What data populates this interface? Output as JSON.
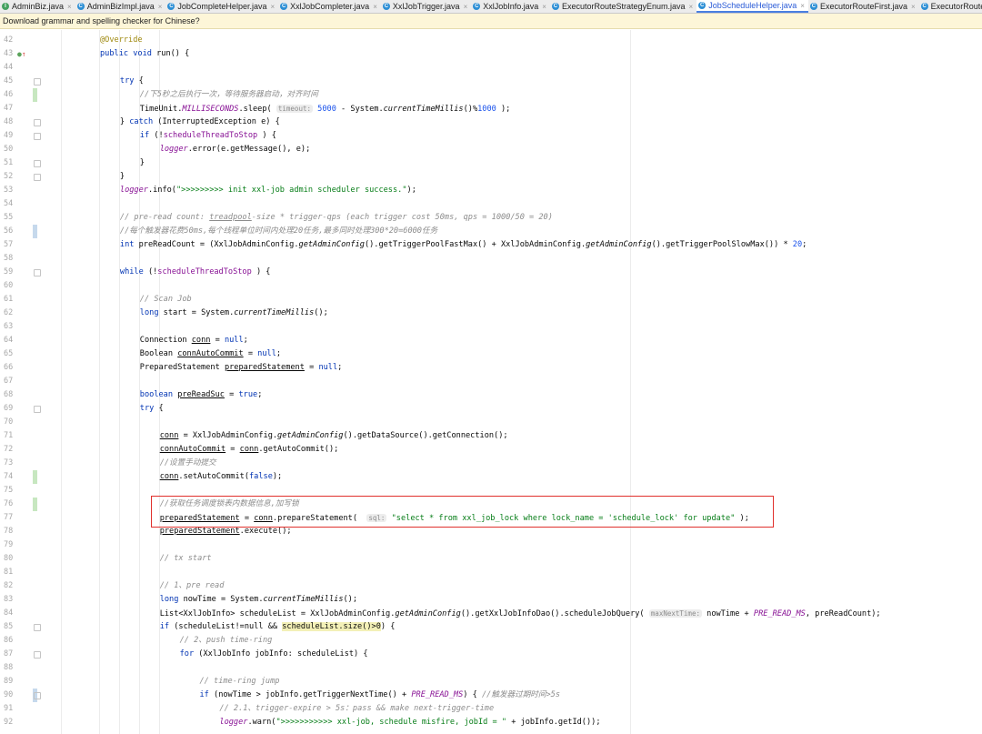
{
  "tabs": [
    {
      "label": "AdminBiz.java",
      "icon": "interface-icon",
      "kind": "iface",
      "active": false
    },
    {
      "label": "AdminBizImpl.java",
      "icon": "class-icon",
      "kind": "class",
      "active": false
    },
    {
      "label": "JobCompleteHelper.java",
      "icon": "class-icon",
      "kind": "class",
      "active": false
    },
    {
      "label": "XxlJobCompleter.java",
      "icon": "class-icon",
      "kind": "class",
      "active": false
    },
    {
      "label": "XxlJobTrigger.java",
      "icon": "class-icon",
      "kind": "class",
      "active": false
    },
    {
      "label": "XxlJobInfo.java",
      "icon": "class-icon",
      "kind": "class",
      "active": false
    },
    {
      "label": "ExecutorRouteStrategyEnum.java",
      "icon": "enum-icon",
      "kind": "class",
      "active": false
    },
    {
      "label": "JobScheduleHelper.java",
      "icon": "class-icon",
      "kind": "class",
      "active": true
    },
    {
      "label": "ExecutorRouteFirst.java",
      "icon": "class-icon",
      "kind": "class",
      "active": false
    },
    {
      "label": "ExecutorRouter.java",
      "icon": "class-icon",
      "kind": "class",
      "active": false
    }
  ],
  "notification": "Download grammar and spelling checker for Chinese?",
  "highlight_color": "#e0302c",
  "lines": [
    {
      "n": "42",
      "indent": 0,
      "code": [
        [
          "ann",
          "@Override"
        ]
      ]
    },
    {
      "n": "43",
      "indent": 0,
      "code": [
        [
          "kw",
          "public void "
        ],
        [
          "",
          "run() {"
        ]
      ],
      "marker": "override"
    },
    {
      "n": "44",
      "indent": 0,
      "code": []
    },
    {
      "n": "45",
      "indent": 1,
      "code": [
        [
          "kw",
          "try"
        ],
        [
          "",
          " {"
        ]
      ],
      "fold": true
    },
    {
      "n": "46",
      "indent": 2,
      "code": [
        [
          "cm",
          "//下5秒之后执行一次，等待服务器启动，对齐时间"
        ]
      ],
      "change": "add"
    },
    {
      "n": "47",
      "indent": 2,
      "code": [
        [
          "",
          "TimeUnit."
        ],
        [
          "sfld",
          "MILLISECONDS"
        ],
        [
          "",
          ".sleep( "
        ],
        [
          "hint",
          "timeout:"
        ],
        [
          "num",
          " 5000"
        ],
        [
          "",
          " - System."
        ],
        [
          "it",
          "currentTimeMillis"
        ],
        [
          "",
          "()%"
        ],
        [
          "num",
          "1000"
        ],
        [
          "",
          " );"
        ]
      ]
    },
    {
      "n": "48",
      "indent": 1,
      "code": [
        [
          "",
          "} "
        ],
        [
          "kw",
          "catch"
        ],
        [
          "",
          " (InterruptedException e) {"
        ]
      ],
      "fold": true
    },
    {
      "n": "49",
      "indent": 2,
      "code": [
        [
          "kw",
          "if"
        ],
        [
          "",
          " (!"
        ],
        [
          "fld",
          "scheduleThreadToStop"
        ],
        [
          "",
          " ) {"
        ]
      ],
      "fold": true
    },
    {
      "n": "50",
      "indent": 3,
      "code": [
        [
          "sfld",
          "logger"
        ],
        [
          "",
          ".error(e.getMessage(), e);"
        ]
      ]
    },
    {
      "n": "51",
      "indent": 2,
      "code": [
        [
          "",
          "}"
        ]
      ],
      "fold": true
    },
    {
      "n": "52",
      "indent": 1,
      "code": [
        [
          "",
          "}"
        ]
      ],
      "fold": true
    },
    {
      "n": "53",
      "indent": 1,
      "code": [
        [
          "sfld",
          "logger"
        ],
        [
          "",
          ".info("
        ],
        [
          "str",
          "\">>>>>>>>> init xxl-job admin scheduler success.\""
        ],
        [
          "",
          ");"
        ]
      ]
    },
    {
      "n": "54",
      "indent": 0,
      "code": []
    },
    {
      "n": "55",
      "indent": 1,
      "code": [
        [
          "cm",
          "// pre-read count: "
        ],
        [
          "cm ul",
          "treadpool"
        ],
        [
          "cm",
          "-size * trigger-qps (each trigger cost 50ms, qps = 1000/50 = 20)"
        ]
      ]
    },
    {
      "n": "56",
      "indent": 1,
      "code": [
        [
          "cm",
          "//每个触发器花费50ms,每个线程单位时间内处理20任务,最多同时处理300*20=6000任务"
        ]
      ],
      "change": "mod"
    },
    {
      "n": "57",
      "indent": 1,
      "code": [
        [
          "kw",
          "int "
        ],
        [
          "",
          "preReadCount = (XxlJobAdminConfig."
        ],
        [
          "it",
          "getAdminConfig"
        ],
        [
          "",
          "().getTriggerPoolFastMax() + XxlJobAdminConfig."
        ],
        [
          "it",
          "getAdminConfig"
        ],
        [
          "",
          "().getTriggerPoolSlowMax()) * "
        ],
        [
          "num",
          "20"
        ],
        [
          "",
          ";"
        ]
      ]
    },
    {
      "n": "58",
      "indent": 0,
      "code": []
    },
    {
      "n": "59",
      "indent": 1,
      "code": [
        [
          "kw",
          "while"
        ],
        [
          "",
          " (!"
        ],
        [
          "fld",
          "scheduleThreadToStop"
        ],
        [
          "",
          " ) {"
        ]
      ],
      "fold": true
    },
    {
      "n": "60",
      "indent": 0,
      "code": []
    },
    {
      "n": "61",
      "indent": 2,
      "code": [
        [
          "cm",
          "// Scan Job"
        ]
      ]
    },
    {
      "n": "62",
      "indent": 2,
      "code": [
        [
          "kw",
          "long "
        ],
        [
          "",
          "start = System."
        ],
        [
          "it",
          "currentTimeMillis"
        ],
        [
          "",
          "();"
        ]
      ]
    },
    {
      "n": "63",
      "indent": 0,
      "code": []
    },
    {
      "n": "64",
      "indent": 2,
      "code": [
        [
          "",
          "Connection "
        ],
        [
          "ul",
          "conn"
        ],
        [
          "",
          " = "
        ],
        [
          "kw",
          "null"
        ],
        [
          "",
          ";"
        ]
      ]
    },
    {
      "n": "65",
      "indent": 2,
      "code": [
        [
          "",
          "Boolean "
        ],
        [
          "ul",
          "connAutoCommit"
        ],
        [
          "",
          " = "
        ],
        [
          "kw",
          "null"
        ],
        [
          "",
          ";"
        ]
      ]
    },
    {
      "n": "66",
      "indent": 2,
      "code": [
        [
          "",
          "PreparedStatement "
        ],
        [
          "ul",
          "preparedStatement"
        ],
        [
          "",
          " = "
        ],
        [
          "kw",
          "null"
        ],
        [
          "",
          ";"
        ]
      ]
    },
    {
      "n": "67",
      "indent": 0,
      "code": []
    },
    {
      "n": "68",
      "indent": 2,
      "code": [
        [
          "kw",
          "boolean "
        ],
        [
          "ul",
          "preReadSuc"
        ],
        [
          "",
          " = "
        ],
        [
          "kw",
          "true"
        ],
        [
          "",
          ";"
        ]
      ]
    },
    {
      "n": "69",
      "indent": 2,
      "code": [
        [
          "kw",
          "try"
        ],
        [
          "",
          " {"
        ]
      ],
      "fold": true
    },
    {
      "n": "70",
      "indent": 0,
      "code": []
    },
    {
      "n": "71",
      "indent": 3,
      "code": [
        [
          "ul",
          "conn"
        ],
        [
          "",
          " = XxlJobAdminConfig."
        ],
        [
          "it",
          "getAdminConfig"
        ],
        [
          "",
          "().getDataSource().getConnection();"
        ]
      ]
    },
    {
      "n": "72",
      "indent": 3,
      "code": [
        [
          "ul",
          "connAutoCommit"
        ],
        [
          "",
          " = "
        ],
        [
          "ul",
          "conn"
        ],
        [
          "",
          ".getAutoCommit();"
        ]
      ]
    },
    {
      "n": "73",
      "indent": 3,
      "code": [
        [
          "cm",
          "//设置手动提交"
        ]
      ]
    },
    {
      "n": "74",
      "indent": 3,
      "code": [
        [
          "ul",
          "conn"
        ],
        [
          "",
          ".setAutoCommit("
        ],
        [
          "kw",
          "false"
        ],
        [
          "",
          ");"
        ]
      ],
      "change": "add"
    },
    {
      "n": "75",
      "indent": 0,
      "code": []
    },
    {
      "n": "76",
      "indent": 3,
      "code": [
        [
          "cm",
          "//获取任务调度锁表内数据信息,加写锁"
        ]
      ],
      "change": "add"
    },
    {
      "n": "77",
      "indent": 3,
      "code": [
        [
          "ul",
          "preparedStatement"
        ],
        [
          "",
          " = "
        ],
        [
          "ul",
          "conn"
        ],
        [
          "",
          ".prepareStatement(  "
        ],
        [
          "hint",
          "sql:"
        ],
        [
          "str",
          " \""
        ],
        [
          "str kw",
          "select"
        ],
        [
          "str",
          " * "
        ],
        [
          "str kw",
          "from"
        ],
        [
          "str",
          " xxl_job_lock "
        ],
        [
          "str kw",
          "where"
        ],
        [
          "str",
          " lock_name = 'schedule_lock' "
        ],
        [
          "str kw",
          "for update"
        ],
        [
          "str",
          "\""
        ],
        [
          "",
          " );"
        ]
      ]
    },
    {
      "n": "78",
      "indent": 3,
      "code": [
        [
          "ul",
          "preparedStatement"
        ],
        [
          "",
          ".execute();"
        ]
      ]
    },
    {
      "n": "79",
      "indent": 0,
      "code": []
    },
    {
      "n": "80",
      "indent": 3,
      "code": [
        [
          "cm",
          "// tx start"
        ]
      ]
    },
    {
      "n": "81",
      "indent": 0,
      "code": []
    },
    {
      "n": "82",
      "indent": 3,
      "code": [
        [
          "cm",
          "// 1、pre read"
        ]
      ]
    },
    {
      "n": "83",
      "indent": 3,
      "code": [
        [
          "kw",
          "long "
        ],
        [
          "",
          "nowTime = System."
        ],
        [
          "it",
          "currentTimeMillis"
        ],
        [
          "",
          "();"
        ]
      ]
    },
    {
      "n": "84",
      "indent": 3,
      "code": [
        [
          "",
          "List<XxlJobInfo> scheduleList = XxlJobAdminConfig."
        ],
        [
          "it",
          "getAdminConfig"
        ],
        [
          "",
          "().getXxlJobInfoDao().scheduleJobQuery( "
        ],
        [
          "hint",
          "maxNextTime:"
        ],
        [
          "",
          " nowTime + "
        ],
        [
          "sfld",
          "PRE_READ_MS"
        ],
        [
          "",
          ", preReadCount);"
        ]
      ]
    },
    {
      "n": "85",
      "indent": 3,
      "code": [
        [
          "kw",
          "if"
        ],
        [
          "",
          " (scheduleList!=null && "
        ],
        [
          "hl",
          "scheduleList.size()>0"
        ],
        [
          "",
          ") {"
        ]
      ],
      "fold": true
    },
    {
      "n": "86",
      "indent": 4,
      "code": [
        [
          "cm",
          "// 2、push time-ring"
        ]
      ]
    },
    {
      "n": "87",
      "indent": 4,
      "code": [
        [
          "kw",
          "for"
        ],
        [
          "",
          " (XxlJobInfo jobInfo: scheduleList) {"
        ]
      ],
      "fold": true
    },
    {
      "n": "88",
      "indent": 0,
      "code": []
    },
    {
      "n": "89",
      "indent": 5,
      "code": [
        [
          "cm",
          "// time-ring jump"
        ]
      ]
    },
    {
      "n": "90",
      "indent": 5,
      "code": [
        [
          "kw",
          "if"
        ],
        [
          "",
          " (nowTime > jobInfo.getTriggerNextTime() + "
        ],
        [
          "sfld",
          "PRE_READ_MS"
        ],
        [
          "",
          ") { "
        ],
        [
          "cm",
          "//触发器过期时间>5s"
        ]
      ],
      "fold": true,
      "change": "mod"
    },
    {
      "n": "91",
      "indent": 6,
      "code": [
        [
          "cm",
          "// 2.1、trigger-expire > 5s：pass && make next-trigger-time"
        ]
      ]
    },
    {
      "n": "92",
      "indent": 6,
      "code": [
        [
          "sfld",
          "logger"
        ],
        [
          "",
          ".warn("
        ],
        [
          "str",
          "\">>>>>>>>>>> xxl-job, schedule misfire, jobId = \""
        ],
        [
          "",
          " + jobInfo.getId());"
        ]
      ]
    }
  ]
}
